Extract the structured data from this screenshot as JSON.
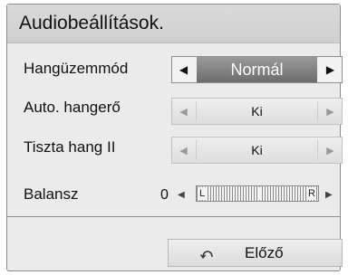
{
  "title": "Audiobeállítások.",
  "rows": [
    {
      "label": "Hangüzemmód",
      "value": "Normál"
    },
    {
      "label": "Auto. hangerő",
      "value": "Ki"
    },
    {
      "label": "Tiszta hang II",
      "value": "Ki"
    }
  ],
  "balance": {
    "label": "Balansz",
    "value": "0",
    "left_label": "L",
    "right_label": "R"
  },
  "back_button": {
    "label": "Előző",
    "icon": "return-icon"
  },
  "icons": {
    "left": "◀",
    "right": "▶"
  },
  "colors": {
    "panel": "#ebebeb",
    "title_bar": "#d4d4d4",
    "focused_value_bg": "#808080",
    "focused_value_text": "#ffffff"
  }
}
